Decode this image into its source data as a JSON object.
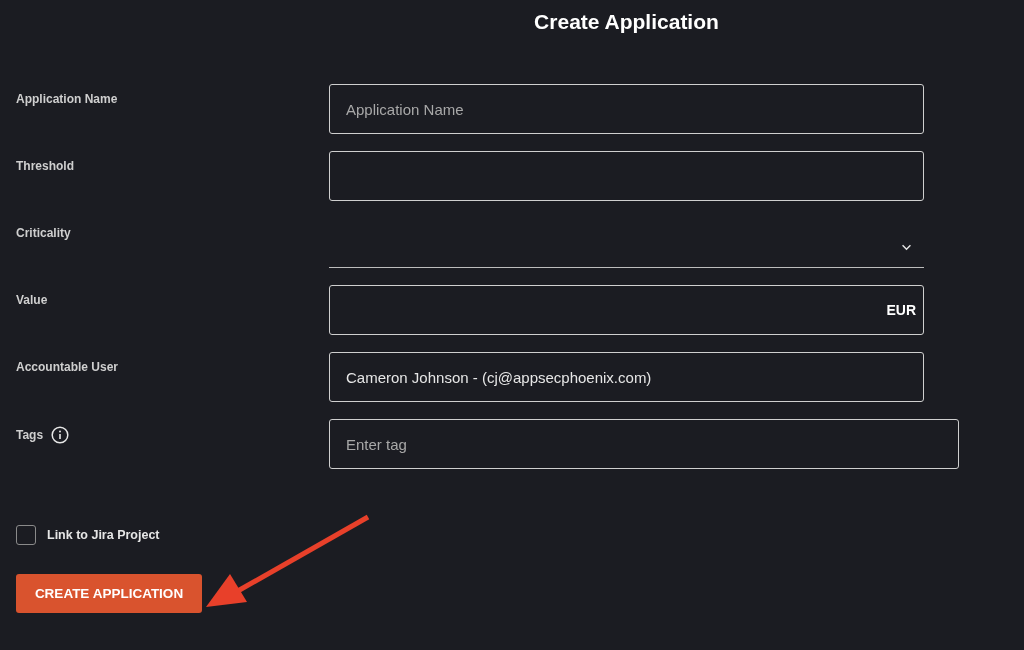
{
  "title": "Create Application",
  "fields": [
    {
      "kind": "text",
      "label": "Application Name",
      "placeholder": "Application Name"
    },
    {
      "kind": "text",
      "label": "Threshold"
    },
    {
      "kind": "select",
      "label": "Criticality"
    },
    {
      "kind": "text",
      "label": "Value",
      "suffix": "EUR"
    },
    {
      "kind": "text",
      "label": "Accountable User",
      "value": "Cameron Johnson - (cj@appsecphoenix.com)"
    },
    {
      "kind": "tags",
      "label": "Tags",
      "placeholder": "Enter tag",
      "info": true
    }
  ],
  "checkbox": {
    "label": "Link to Jira Project",
    "checked": false
  },
  "button": "CREATE APPLICATION"
}
